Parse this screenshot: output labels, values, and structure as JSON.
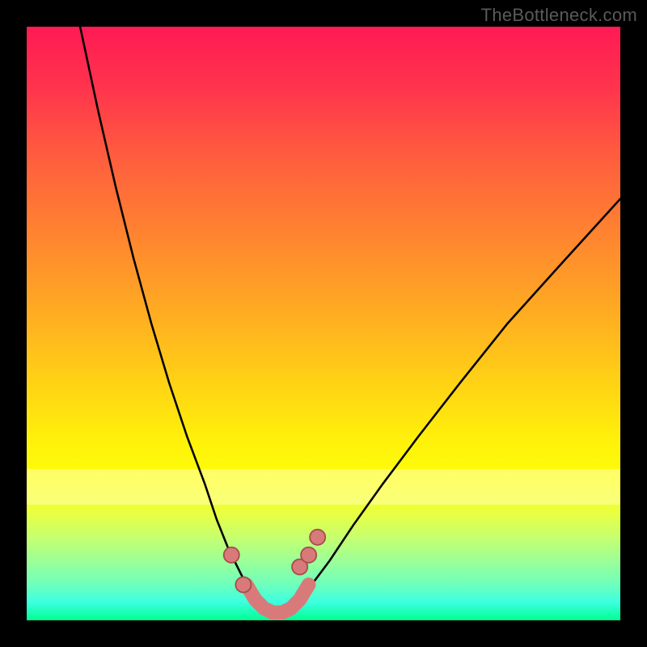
{
  "watermark": "TheBottleneck.com",
  "colors": {
    "frame": "#000000",
    "gradient_top": "#ff1a54",
    "gradient_mid1": "#ff7e32",
    "gradient_mid2": "#fff20a",
    "gradient_bottom": "#00ff90",
    "curve_stroke": "#000000",
    "marker_fill": "#d97a7a",
    "marker_stroke": "#a64d4d"
  },
  "chart_data": {
    "type": "line",
    "title": "",
    "xlabel": "",
    "ylabel": "",
    "xlim": [
      0,
      100
    ],
    "ylim": [
      0,
      100
    ],
    "grid": false,
    "legend": false,
    "series": [
      {
        "name": "left-curve",
        "x": [
          9,
          12,
          15,
          18,
          21,
          24,
          27,
          30,
          32,
          34,
          35.5,
          37,
          38.5,
          40
        ],
        "y": [
          100,
          86,
          73,
          61,
          50,
          40,
          31,
          23,
          17,
          12,
          9,
          6,
          3.5,
          1.5
        ]
      },
      {
        "name": "right-curve",
        "x": [
          44,
          46,
          48,
          51,
          55,
          60,
          66,
          73,
          81,
          90,
          100
        ],
        "y": [
          1.5,
          3.5,
          6,
          10,
          16,
          23,
          31,
          40,
          50,
          60,
          71
        ]
      },
      {
        "name": "trough-band",
        "x": [
          37,
          38.5,
          40,
          41.5,
          43,
          44.5,
          46,
          47.5
        ],
        "y": [
          6,
          3.5,
          2,
          1.3,
          1.3,
          2,
          3.5,
          6
        ]
      }
    ],
    "markers": [
      {
        "x": 34.5,
        "y": 11,
        "r": 1.3
      },
      {
        "x": 36.5,
        "y": 6,
        "r": 1.3
      },
      {
        "x": 46.0,
        "y": 9,
        "r": 1.3
      },
      {
        "x": 47.5,
        "y": 11,
        "r": 1.3
      },
      {
        "x": 49.0,
        "y": 14,
        "r": 1.3
      }
    ],
    "annotations": []
  }
}
